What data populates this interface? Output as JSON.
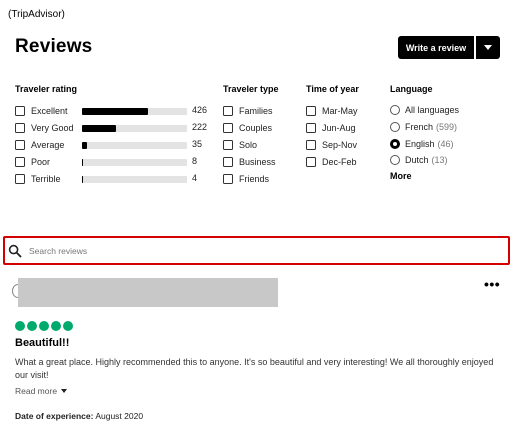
{
  "source_label": "(TripAdvisor)",
  "header": {
    "title": "Reviews",
    "write_review_label": "Write a review"
  },
  "filters": {
    "traveler_rating": {
      "title": "Traveler rating",
      "items": [
        {
          "label": "Excellent",
          "count": "426",
          "fraction": 0.52
        },
        {
          "label": "Very Good",
          "count": "222",
          "fraction": 0.27
        },
        {
          "label": "Average",
          "count": "35",
          "fraction": 0.04
        },
        {
          "label": "Poor",
          "count": "8",
          "fraction": 0.01
        },
        {
          "label": "Terrible",
          "count": "4",
          "fraction": 0.005
        }
      ]
    },
    "traveler_type": {
      "title": "Traveler type",
      "items": [
        "Families",
        "Couples",
        "Solo",
        "Business",
        "Friends"
      ]
    },
    "time_of_year": {
      "title": "Time of year",
      "items": [
        "Mar-May",
        "Jun-Aug",
        "Sep-Nov",
        "Dec-Feb"
      ]
    },
    "language": {
      "title": "Language",
      "items": [
        {
          "label": "All languages",
          "count": "",
          "selected": false
        },
        {
          "label": "French",
          "count": "(599)",
          "selected": false
        },
        {
          "label": "English",
          "count": "(46)",
          "selected": true
        },
        {
          "label": "Dutch",
          "count": "(13)",
          "selected": false
        }
      ],
      "more_label": "More"
    }
  },
  "search": {
    "placeholder": "Search reviews"
  },
  "review": {
    "more_menu": "•••",
    "rating_bubbles": 5,
    "bubble_color": "#00aa6c",
    "title": "Beautiful!!",
    "text": "What a great place. Highly recommended this to anyone. It's so beautiful and very interesting! We all thoroughly enjoyed our visit!",
    "read_more_label": "Read more",
    "date_label": "Date of experience:",
    "date_value": "August 2020"
  }
}
